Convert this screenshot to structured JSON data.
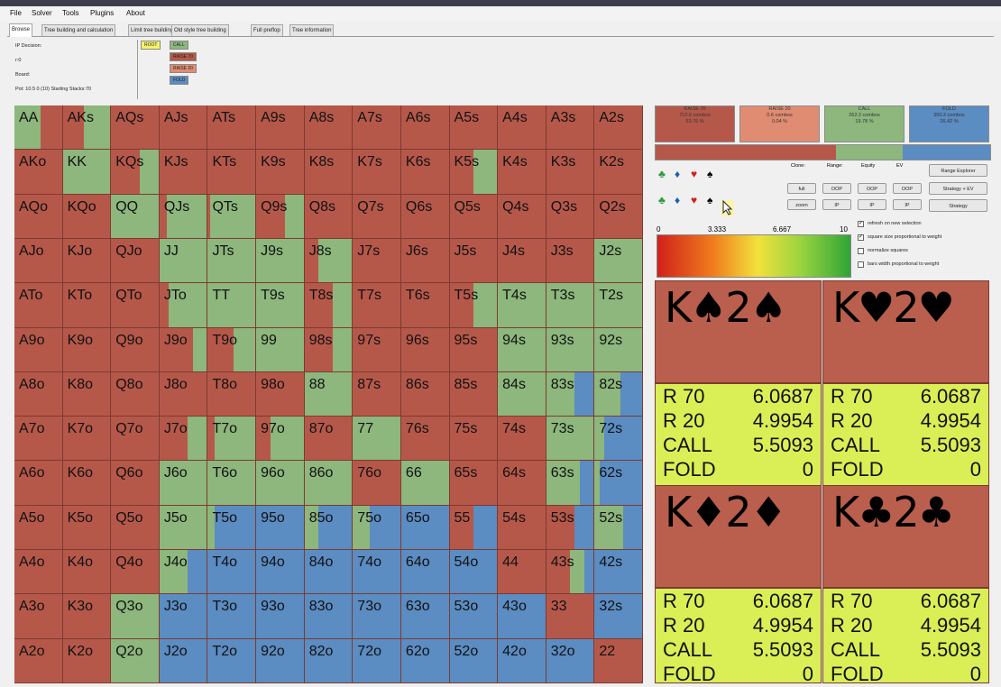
{
  "menu": [
    "File",
    "Solver",
    "Tools",
    "Plugins",
    "About"
  ],
  "tabs": [
    "Browse",
    "Tree building and calculation",
    "Limit tree building",
    "Old style tree building",
    "Full preflop",
    "Tree information"
  ],
  "info": {
    "decision": "IP Decision:",
    "r": "r:0",
    "board": "Board:",
    "pot": "Pot: 10.5 0 (10) Starting Stacks:70"
  },
  "tree_buttons": [
    "ROOT",
    "CALL",
    "RAISE 70",
    "RAISE 20",
    "FOLD"
  ],
  "colors": {
    "raise70": "#b5584a",
    "raise20": "#e08c72",
    "call": "#8db77d",
    "fold": "#5b8cc2",
    "value_bg": "#d9ef55"
  },
  "grid": [
    [
      "AA",
      "AKs",
      "AQs",
      "AJs",
      "ATs",
      "A9s",
      "A8s",
      "A7s",
      "A6s",
      "A5s",
      "A4s",
      "A3s",
      "A2s"
    ],
    [
      "AKo",
      "KK",
      "KQs",
      "KJs",
      "KTs",
      "K9s",
      "K8s",
      "K7s",
      "K6s",
      "K5s",
      "K4s",
      "K3s",
      "K2s"
    ],
    [
      "AQo",
      "KQo",
      "QQ",
      "QJs",
      "QTs",
      "Q9s",
      "Q8s",
      "Q7s",
      "Q6s",
      "Q5s",
      "Q4s",
      "Q3s",
      "Q2s"
    ],
    [
      "AJo",
      "KJo",
      "QJo",
      "JJ",
      "JTs",
      "J9s",
      "J8s",
      "J7s",
      "J6s",
      "J5s",
      "J4s",
      "J3s",
      "J2s"
    ],
    [
      "ATo",
      "KTo",
      "QTo",
      "JTo",
      "TT",
      "T9s",
      "T8s",
      "T7s",
      "T6s",
      "T5s",
      "T4s",
      "T3s",
      "T2s"
    ],
    [
      "A9o",
      "K9o",
      "Q9o",
      "J9o",
      "T9o",
      "99",
      "98s",
      "97s",
      "96s",
      "95s",
      "94s",
      "93s",
      "92s"
    ],
    [
      "A8o",
      "K8o",
      "Q8o",
      "J8o",
      "T8o",
      "98o",
      "88",
      "87s",
      "86s",
      "85s",
      "84s",
      "83s",
      "82s"
    ],
    [
      "A7o",
      "K7o",
      "Q7o",
      "J7o",
      "T7o",
      "97o",
      "87o",
      "77",
      "76s",
      "75s",
      "74s",
      "73s",
      "72s"
    ],
    [
      "A6o",
      "K6o",
      "Q6o",
      "J6o",
      "T6o",
      "96o",
      "86o",
      "76o",
      "66",
      "65s",
      "64s",
      "63s",
      "62s"
    ],
    [
      "A5o",
      "K5o",
      "Q5o",
      "J5o",
      "T5o",
      "95o",
      "85o",
      "75o",
      "65o",
      "55",
      "54s",
      "53s",
      "52s"
    ],
    [
      "A4o",
      "K4o",
      "Q4o",
      "J4o",
      "T4o",
      "94o",
      "84o",
      "74o",
      "64o",
      "54o",
      "44",
      "43s",
      "42s"
    ],
    [
      "A3o",
      "K3o",
      "Q3o",
      "J3o",
      "T3o",
      "93o",
      "83o",
      "73o",
      "63o",
      "53o",
      "43o",
      "33",
      "32s"
    ],
    [
      "A2o",
      "K2o",
      "Q2o",
      "J2o",
      "T2o",
      "92o",
      "82o",
      "72o",
      "62o",
      "52o",
      "42o",
      "32o",
      "22"
    ]
  ],
  "summary": [
    {
      "name": "RAISE 70",
      "combos": "712.9 combos",
      "pct": "53.76 %"
    },
    {
      "name": "RAISE 20",
      "combos": "0.6 combos",
      "pct": "0.04 %"
    },
    {
      "name": "CALL",
      "combos": "262.2 combos",
      "pct": "19.78 %"
    },
    {
      "name": "FOLD",
      "combos": "350.3 combos",
      "pct": "26.42 %"
    }
  ],
  "controls": {
    "labels": [
      "Clone:",
      "Range:",
      "Equity",
      "EV"
    ],
    "full": "full",
    "zoom": "zoom",
    "oop": "OOP",
    "ip": "IP",
    "range_explorer": "Range Explorer",
    "strategy_ev": "Strategy + EV",
    "strategy": "Strategy"
  },
  "scale": {
    "min": "0",
    "t1": "3.333",
    "t2": "6.667",
    "max": "10"
  },
  "options": [
    {
      "label": "refresh on new selection",
      "checked": true
    },
    {
      "label": "square size proportional to weight",
      "checked": true
    },
    {
      "label": "normalize squares",
      "checked": false
    },
    {
      "label": "bars width proportional to weight",
      "checked": false
    }
  ],
  "hands": [
    {
      "cards": "K♠2♠",
      "values": [
        [
          "R 70",
          "6.0687"
        ],
        [
          "R 20",
          "4.9954"
        ],
        [
          "CALL",
          "5.5093"
        ],
        [
          "FOLD",
          "0"
        ]
      ]
    },
    {
      "cards": "K♥2♥",
      "values": [
        [
          "R 70",
          "6.0687"
        ],
        [
          "R 20",
          "4.9954"
        ],
        [
          "CALL",
          "5.5093"
        ],
        [
          "FOLD",
          "0"
        ]
      ]
    },
    {
      "cards": "K♦2♦",
      "values": [
        [
          "R 70",
          "6.0687"
        ],
        [
          "R 20",
          "4.9954"
        ],
        [
          "CALL",
          "5.5093"
        ],
        [
          "FOLD",
          "0"
        ]
      ]
    },
    {
      "cards": "K♣2♣",
      "values": [
        [
          "R 70",
          "6.0687"
        ],
        [
          "R 20",
          "4.9954"
        ],
        [
          "CALL",
          "5.5093"
        ],
        [
          "FOLD",
          "0"
        ]
      ]
    }
  ]
}
